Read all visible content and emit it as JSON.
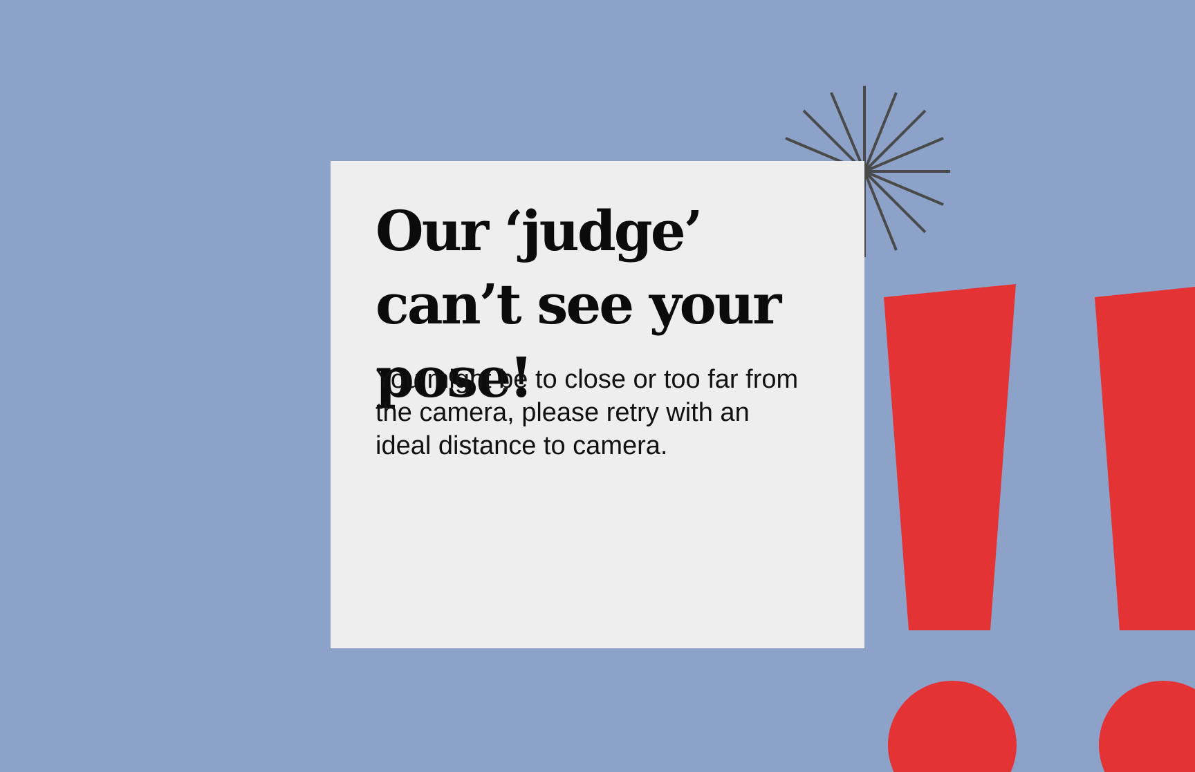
{
  "dialog": {
    "title": "Our ‘judge’ can’t see your pose!",
    "message": "You might be to close or too far from the camera, please retry with an ideal distance to camera."
  },
  "colors": {
    "background": "#8da2c8",
    "card": "#eeeeee",
    "accent": "#e43335",
    "burst": "#4a4a4a"
  },
  "icons": {
    "burst": "starburst-icon",
    "alert": "exclamation-icon"
  }
}
